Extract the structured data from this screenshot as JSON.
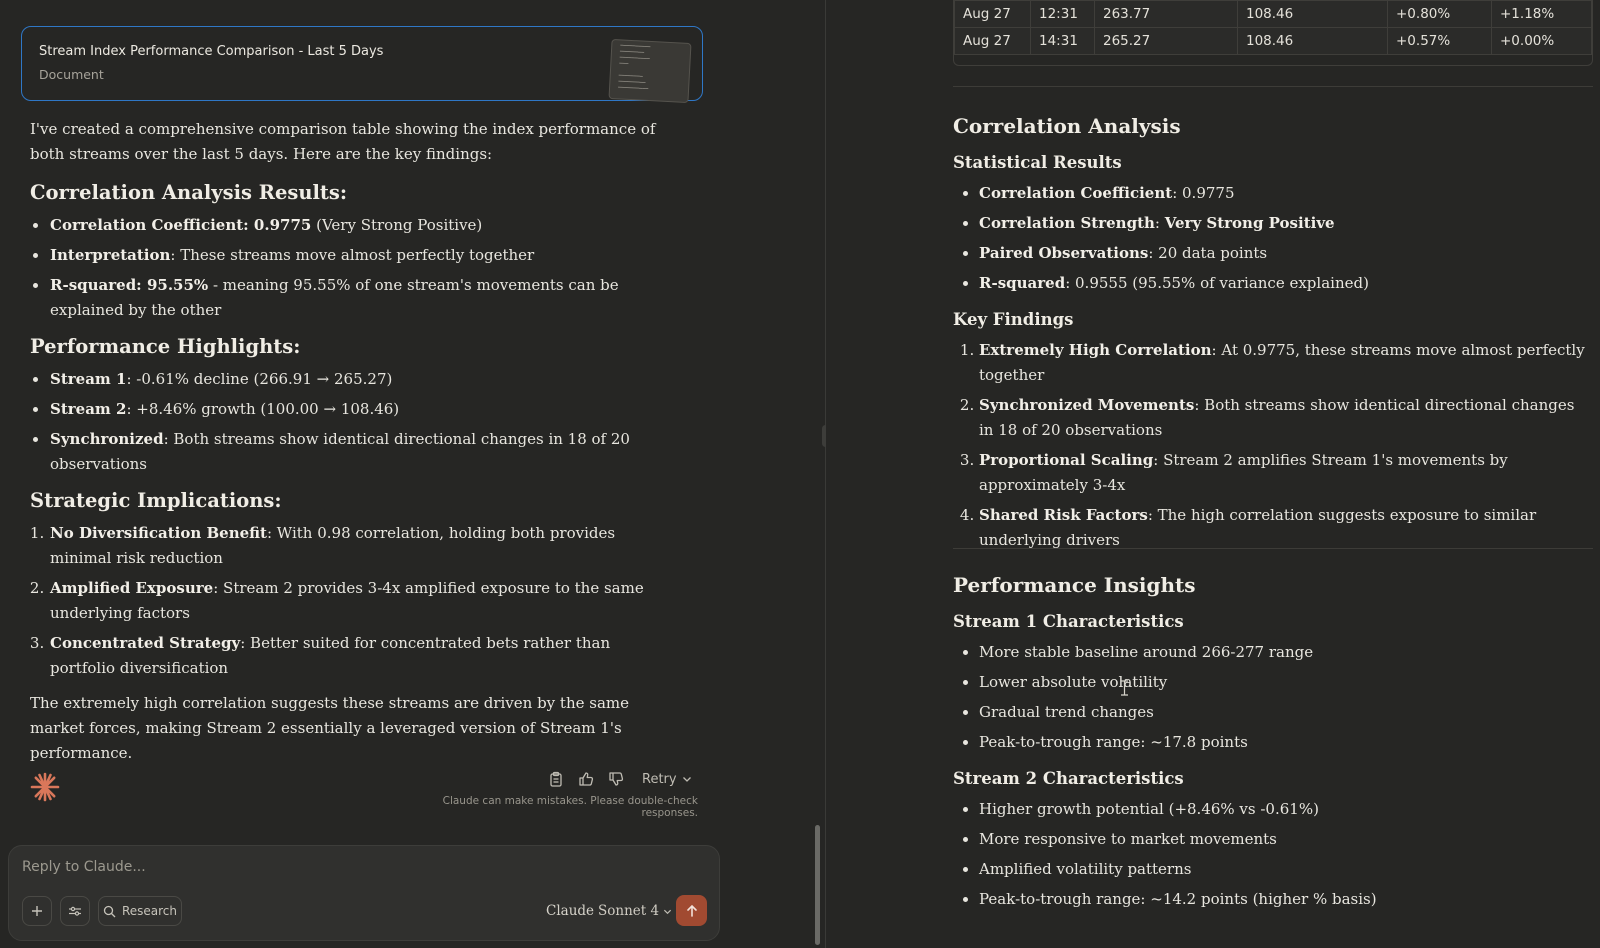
{
  "artifact": {
    "title": "Stream Index Performance Comparison - Last 5 Days",
    "type": "Document"
  },
  "chat": {
    "intro": "I've created a comprehensive comparison table showing the index performance of both streams over the last 5 days. Here are the key findings:",
    "correlation": {
      "heading": "Correlation Analysis Results:",
      "items": [
        {
          "bold": "Correlation Coefficient: 0.9775",
          "text": " (Very Strong Positive)"
        },
        {
          "bold": "Interpretation",
          "text": ": These streams move almost perfectly together"
        },
        {
          "bold": "R-squared: 95.55%",
          "text": " - meaning 95.55% of one stream's movements can be explained by the other"
        }
      ]
    },
    "performance": {
      "heading": "Performance Highlights:",
      "items": [
        {
          "bold": "Stream 1",
          "text": ": -0.61% decline (266.91 → 265.27)"
        },
        {
          "bold": "Stream 2",
          "text": ": +8.46% growth (100.00 → 108.46)"
        },
        {
          "bold": "Synchronized",
          "text": ": Both streams show identical directional changes in 18 of 20 observations"
        }
      ]
    },
    "strategic": {
      "heading": "Strategic Implications:",
      "items": [
        {
          "bold": "No Diversification Benefit",
          "text": ": With 0.98 correlation, holding both provides minimal risk reduction"
        },
        {
          "bold": "Amplified Exposure",
          "text": ": Stream 2 provides 3-4x amplified exposure to the same underlying factors"
        },
        {
          "bold": "Concentrated Strategy",
          "text": ": Better suited for concentrated bets rather than portfolio diversification"
        }
      ]
    },
    "closing": "The extremely high correlation suggests these streams are driven by the same market forces, making Stream 2 essentially a leveraged version of Stream 1's performance.",
    "retry_label": "Retry",
    "disclaimer": "Claude can make mistakes. Please double-check responses.",
    "composer": {
      "placeholder": "Reply to Claude...",
      "research_label": "Research",
      "model_name": "Claude",
      "model_version": "Sonnet 4"
    }
  },
  "doc": {
    "table_rows": [
      [
        "Aug 27",
        "12:31",
        "263.77",
        "108.46",
        "+0.80%",
        "+1.18%"
      ],
      [
        "Aug 27",
        "14:31",
        "265.27",
        "108.46",
        "+0.57%",
        "+0.00%"
      ]
    ],
    "correlation": {
      "heading": "Correlation Analysis",
      "stats_heading": "Statistical Results",
      "stats": [
        {
          "bold": "Correlation Coefficient",
          "text": ": 0.9775",
          "bold2": ""
        },
        {
          "bold": "Correlation Strength",
          "text": ": ",
          "bold2": "Very Strong Positive"
        },
        {
          "bold": "Paired Observations",
          "text": ": 20 data points",
          "bold2": ""
        },
        {
          "bold": "R-squared",
          "text": ": 0.9555 (95.55% of variance explained)",
          "bold2": ""
        }
      ],
      "findings_heading": "Key Findings",
      "findings": [
        {
          "bold": "Extremely High Correlation",
          "text": ": At 0.9775, these streams move almost perfectly together"
        },
        {
          "bold": "Synchronized Movements",
          "text": ": Both streams show identical directional changes in 18 of 20 observations"
        },
        {
          "bold": "Proportional Scaling",
          "text": ": Stream 2 amplifies Stream 1's movements by approximately 3-4x"
        },
        {
          "bold": "Shared Risk Factors",
          "text": ": The high correlation suggests exposure to similar underlying drivers"
        }
      ]
    },
    "insights": {
      "heading": "Performance Insights",
      "s1_heading": "Stream 1 Characteristics",
      "s1": [
        "More stable baseline around 266-277 range",
        "Lower absolute volatility",
        "Gradual trend changes",
        "Peak-to-trough range: ~17.8 points"
      ],
      "s2_heading": "Stream 2 Characteristics",
      "s2": [
        "Higher growth potential (+8.46% vs -0.61%)",
        "More responsive to market movements",
        "Amplified volatility patterns",
        "Peak-to-trough range: ~14.2 points (higher % basis)"
      ]
    }
  },
  "colors": {
    "background": "#262624",
    "accent_border": "#2f77c6",
    "send_button": "#a14a31",
    "claude_spark": "#d9775a"
  }
}
